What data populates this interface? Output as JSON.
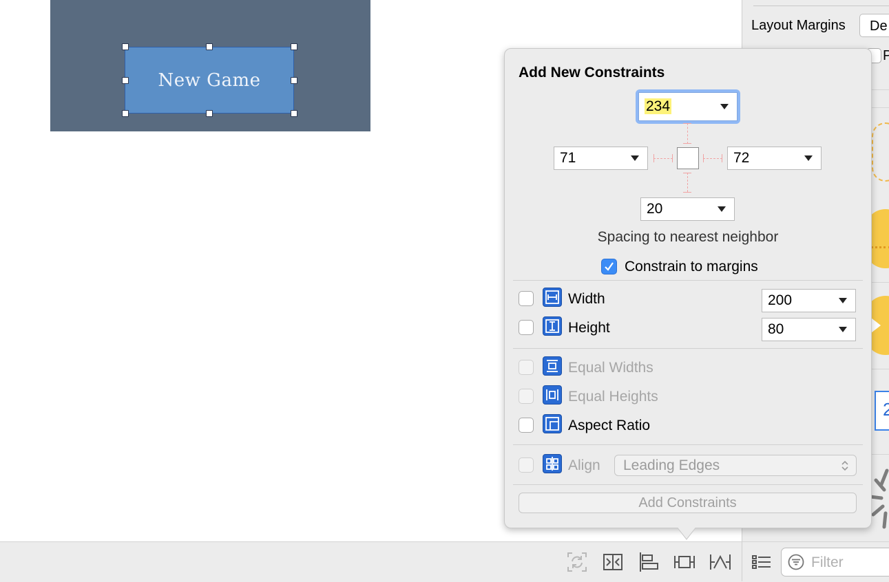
{
  "canvas": {
    "button_title": "New Game"
  },
  "inspector": {
    "layout_margins_label": "Layout Margins",
    "layout_margins_value": "De",
    "partial_check_label": "P",
    "partial_field_value": "2"
  },
  "popover": {
    "title": "Add New Constraints",
    "top_value": "234",
    "leading_value": "71",
    "trailing_value": "72",
    "bottom_value": "20",
    "spacing_caption": "Spacing to nearest neighbor",
    "constrain_margins": {
      "label": "Constrain to margins",
      "checked": true
    },
    "width": {
      "label": "Width",
      "value": "200",
      "checked": false
    },
    "height": {
      "label": "Height",
      "value": "80",
      "checked": false
    },
    "equal_widths": {
      "label": "Equal Widths",
      "enabled": false
    },
    "equal_heights": {
      "label": "Equal Heights",
      "enabled": false
    },
    "aspect_ratio": {
      "label": "Aspect Ratio",
      "checked": false
    },
    "align": {
      "label": "Align",
      "value": "Leading Edges",
      "enabled": false
    },
    "add_button": "Add Constraints"
  },
  "bottom_bar": {
    "filter_placeholder": "Filter",
    "icons": [
      "update-frames-icon",
      "stack-icon",
      "align-icon",
      "pin-icon",
      "resolve-issues-icon"
    ]
  },
  "colors": {
    "accent": "#2a6bd4",
    "highlight": "#fdf27a",
    "canvas_bg": "#596b80",
    "button_bg": "#5b8fc7"
  }
}
